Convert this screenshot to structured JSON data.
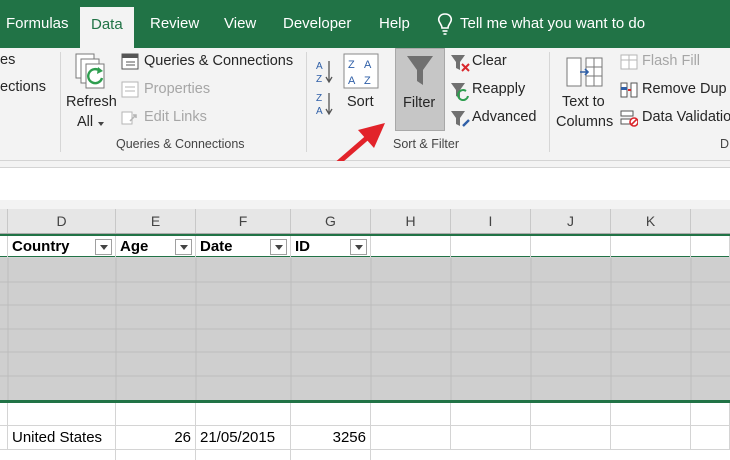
{
  "menu": {
    "items": [
      "Formulas",
      "Data",
      "Review",
      "View",
      "Developer",
      "Help"
    ],
    "tell_me": "Tell me what you want to do"
  },
  "ribbon": {
    "get_data_partial": [
      "es",
      "ections"
    ],
    "refresh_all": [
      "Refresh",
      "All"
    ],
    "queries_connections": "Queries & Connections",
    "properties": "Properties",
    "edit_links": "Edit Links",
    "sort": "Sort",
    "filter": "Filter",
    "clear": "Clear",
    "reapply": "Reapply",
    "advanced": "Advanced",
    "text_to_columns": [
      "Text to",
      "Columns"
    ],
    "flash_fill": "Flash Fill",
    "remove_duplicates": "Remove Dup",
    "data_validation": "Data Validatio",
    "groups": {
      "queries": "Queries & Connections",
      "sort_filter": "Sort & Filter",
      "data_tools_partial": "D"
    }
  },
  "grid": {
    "columns": [
      "D",
      "E",
      "F",
      "G",
      "H",
      "I",
      "J",
      "K"
    ],
    "headers": [
      "Country",
      "Age",
      "Date",
      "ID"
    ],
    "row1": {
      "country": "United States",
      "age": "26",
      "date": "21/05/2015",
      "id": "3256"
    }
  },
  "colors": {
    "ribbon_green": "#217346",
    "filter_active": "#c6c6c6",
    "arrow_red": "#e2232a"
  }
}
